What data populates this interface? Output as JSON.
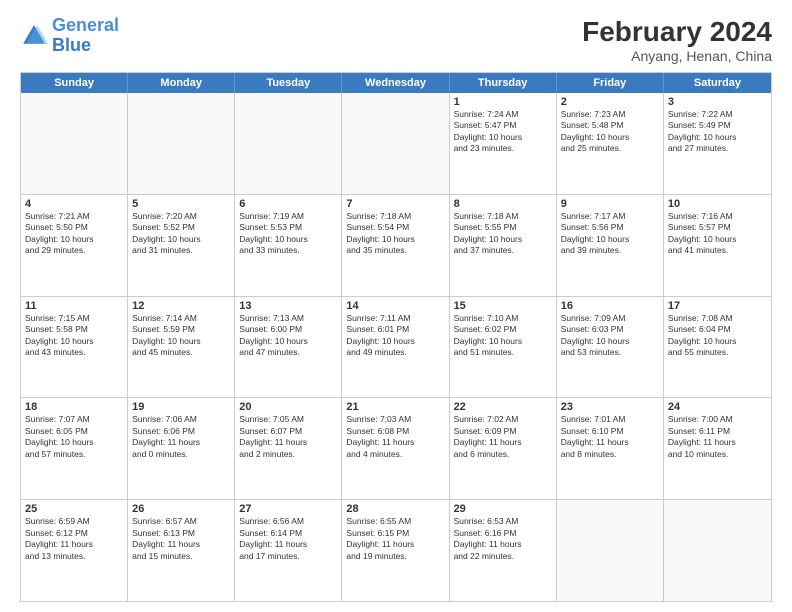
{
  "header": {
    "logo_line1": "General",
    "logo_line2": "Blue",
    "main_title": "February 2024",
    "sub_title": "Anyang, Henan, China"
  },
  "days_of_week": [
    "Sunday",
    "Monday",
    "Tuesday",
    "Wednesday",
    "Thursday",
    "Friday",
    "Saturday"
  ],
  "rows": [
    [
      {
        "day": "",
        "empty": true
      },
      {
        "day": "",
        "empty": true
      },
      {
        "day": "",
        "empty": true
      },
      {
        "day": "",
        "empty": true
      },
      {
        "day": "1",
        "lines": [
          "Sunrise: 7:24 AM",
          "Sunset: 5:47 PM",
          "Daylight: 10 hours",
          "and 23 minutes."
        ]
      },
      {
        "day": "2",
        "lines": [
          "Sunrise: 7:23 AM",
          "Sunset: 5:48 PM",
          "Daylight: 10 hours",
          "and 25 minutes."
        ]
      },
      {
        "day": "3",
        "lines": [
          "Sunrise: 7:22 AM",
          "Sunset: 5:49 PM",
          "Daylight: 10 hours",
          "and 27 minutes."
        ]
      }
    ],
    [
      {
        "day": "4",
        "lines": [
          "Sunrise: 7:21 AM",
          "Sunset: 5:50 PM",
          "Daylight: 10 hours",
          "and 29 minutes."
        ]
      },
      {
        "day": "5",
        "lines": [
          "Sunrise: 7:20 AM",
          "Sunset: 5:52 PM",
          "Daylight: 10 hours",
          "and 31 minutes."
        ]
      },
      {
        "day": "6",
        "lines": [
          "Sunrise: 7:19 AM",
          "Sunset: 5:53 PM",
          "Daylight: 10 hours",
          "and 33 minutes."
        ]
      },
      {
        "day": "7",
        "lines": [
          "Sunrise: 7:18 AM",
          "Sunset: 5:54 PM",
          "Daylight: 10 hours",
          "and 35 minutes."
        ]
      },
      {
        "day": "8",
        "lines": [
          "Sunrise: 7:18 AM",
          "Sunset: 5:55 PM",
          "Daylight: 10 hours",
          "and 37 minutes."
        ]
      },
      {
        "day": "9",
        "lines": [
          "Sunrise: 7:17 AM",
          "Sunset: 5:56 PM",
          "Daylight: 10 hours",
          "and 39 minutes."
        ]
      },
      {
        "day": "10",
        "lines": [
          "Sunrise: 7:16 AM",
          "Sunset: 5:57 PM",
          "Daylight: 10 hours",
          "and 41 minutes."
        ]
      }
    ],
    [
      {
        "day": "11",
        "lines": [
          "Sunrise: 7:15 AM",
          "Sunset: 5:58 PM",
          "Daylight: 10 hours",
          "and 43 minutes."
        ]
      },
      {
        "day": "12",
        "lines": [
          "Sunrise: 7:14 AM",
          "Sunset: 5:59 PM",
          "Daylight: 10 hours",
          "and 45 minutes."
        ]
      },
      {
        "day": "13",
        "lines": [
          "Sunrise: 7:13 AM",
          "Sunset: 6:00 PM",
          "Daylight: 10 hours",
          "and 47 minutes."
        ]
      },
      {
        "day": "14",
        "lines": [
          "Sunrise: 7:11 AM",
          "Sunset: 6:01 PM",
          "Daylight: 10 hours",
          "and 49 minutes."
        ]
      },
      {
        "day": "15",
        "lines": [
          "Sunrise: 7:10 AM",
          "Sunset: 6:02 PM",
          "Daylight: 10 hours",
          "and 51 minutes."
        ]
      },
      {
        "day": "16",
        "lines": [
          "Sunrise: 7:09 AM",
          "Sunset: 6:03 PM",
          "Daylight: 10 hours",
          "and 53 minutes."
        ]
      },
      {
        "day": "17",
        "lines": [
          "Sunrise: 7:08 AM",
          "Sunset: 6:04 PM",
          "Daylight: 10 hours",
          "and 55 minutes."
        ]
      }
    ],
    [
      {
        "day": "18",
        "lines": [
          "Sunrise: 7:07 AM",
          "Sunset: 6:05 PM",
          "Daylight: 10 hours",
          "and 57 minutes."
        ]
      },
      {
        "day": "19",
        "lines": [
          "Sunrise: 7:06 AM",
          "Sunset: 6:06 PM",
          "Daylight: 11 hours",
          "and 0 minutes."
        ]
      },
      {
        "day": "20",
        "lines": [
          "Sunrise: 7:05 AM",
          "Sunset: 6:07 PM",
          "Daylight: 11 hours",
          "and 2 minutes."
        ]
      },
      {
        "day": "21",
        "lines": [
          "Sunrise: 7:03 AM",
          "Sunset: 6:08 PM",
          "Daylight: 11 hours",
          "and 4 minutes."
        ]
      },
      {
        "day": "22",
        "lines": [
          "Sunrise: 7:02 AM",
          "Sunset: 6:09 PM",
          "Daylight: 11 hours",
          "and 6 minutes."
        ]
      },
      {
        "day": "23",
        "lines": [
          "Sunrise: 7:01 AM",
          "Sunset: 6:10 PM",
          "Daylight: 11 hours",
          "and 8 minutes."
        ]
      },
      {
        "day": "24",
        "lines": [
          "Sunrise: 7:00 AM",
          "Sunset: 6:11 PM",
          "Daylight: 11 hours",
          "and 10 minutes."
        ]
      }
    ],
    [
      {
        "day": "25",
        "lines": [
          "Sunrise: 6:59 AM",
          "Sunset: 6:12 PM",
          "Daylight: 11 hours",
          "and 13 minutes."
        ]
      },
      {
        "day": "26",
        "lines": [
          "Sunrise: 6:57 AM",
          "Sunset: 6:13 PM",
          "Daylight: 11 hours",
          "and 15 minutes."
        ]
      },
      {
        "day": "27",
        "lines": [
          "Sunrise: 6:56 AM",
          "Sunset: 6:14 PM",
          "Daylight: 11 hours",
          "and 17 minutes."
        ]
      },
      {
        "day": "28",
        "lines": [
          "Sunrise: 6:55 AM",
          "Sunset: 6:15 PM",
          "Daylight: 11 hours",
          "and 19 minutes."
        ]
      },
      {
        "day": "29",
        "lines": [
          "Sunrise: 6:53 AM",
          "Sunset: 6:16 PM",
          "Daylight: 11 hours",
          "and 22 minutes."
        ]
      },
      {
        "day": "",
        "empty": true
      },
      {
        "day": "",
        "empty": true
      }
    ]
  ]
}
